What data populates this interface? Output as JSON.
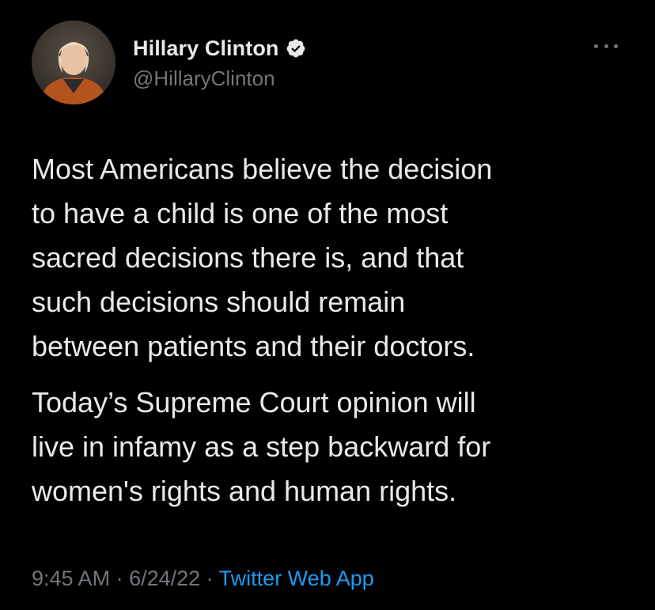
{
  "author": {
    "display_name": "Hillary Clinton",
    "handle": "@HillaryClinton",
    "verified": true,
    "avatar_icon": "profile-photo"
  },
  "tweet": {
    "paragraphs": [
      "Most Americans believe the decision\nto have a child is one of the most\nsacred decisions there is, and that\nsuch decisions should remain\nbetween patients and their doctors.",
      "Today’s Supreme Court opinion will\nlive in infamy as a step backward for\nwomen's rights and human rights."
    ]
  },
  "meta": {
    "time": "9:45 AM",
    "separator": " · ",
    "date": "6/24/22",
    "source": "Twitter Web App"
  },
  "colors": {
    "background": "#000000",
    "text": "#e7e9ea",
    "secondary": "#71767b",
    "link": "#1d9bf0"
  },
  "icons": {
    "more": "more-dots-icon",
    "verified": "verified-badge-icon"
  }
}
